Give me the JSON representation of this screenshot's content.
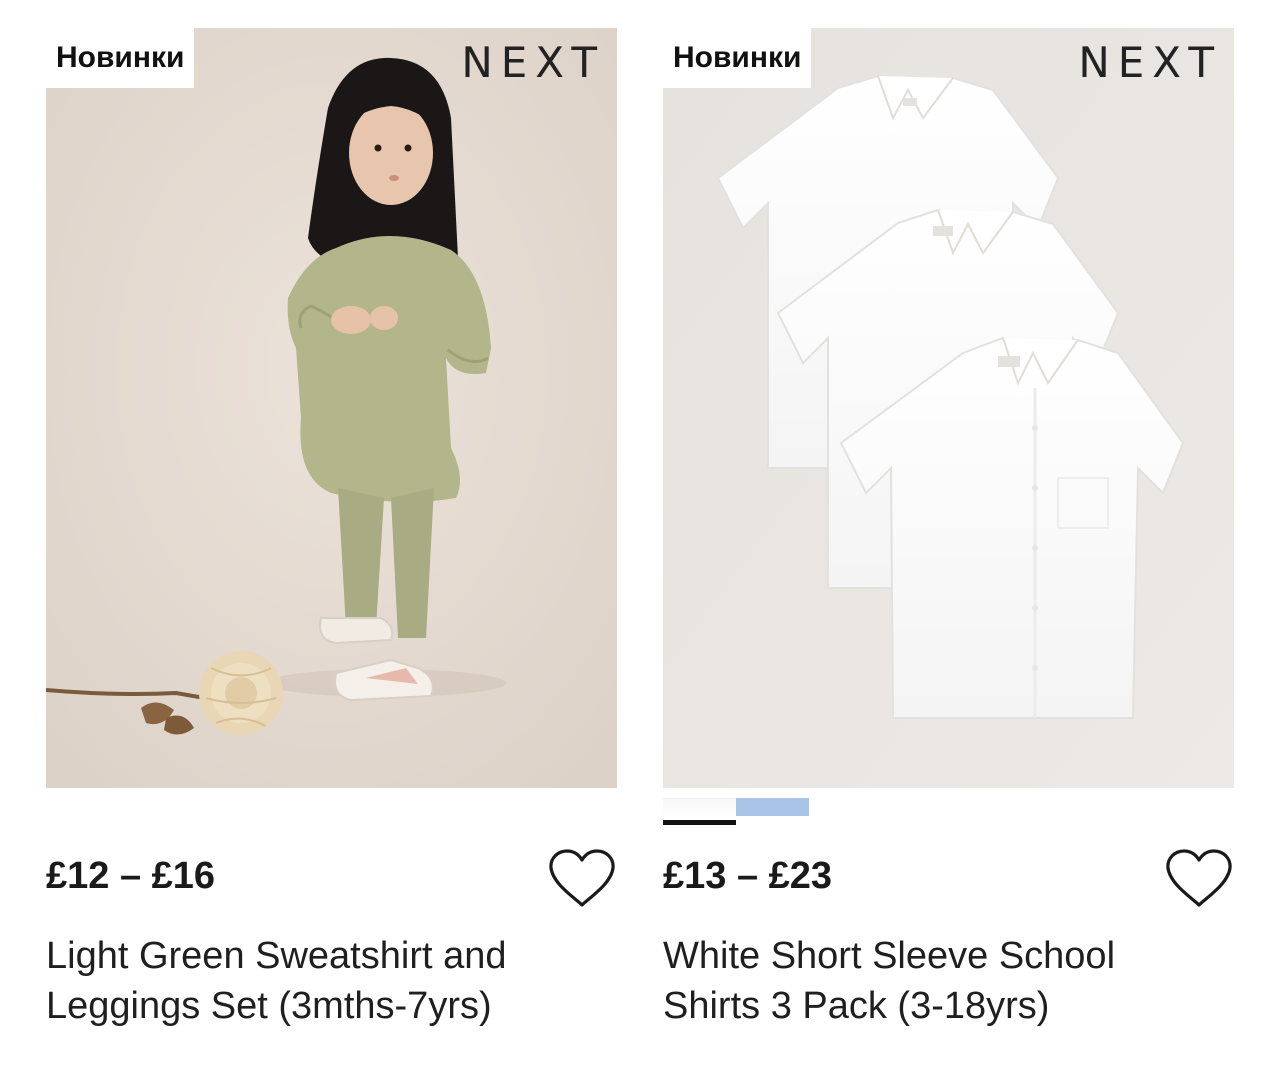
{
  "products": [
    {
      "badge": "Новинки",
      "brand": "NEXT",
      "price": "£12 – £16",
      "title_lines": [
        "Light Green Sweatshirt and",
        "Leggings Set (3mths-7yrs)"
      ],
      "image_icon": "child-in-green-outfit-photo",
      "colors": {
        "bg": "#e5dbd2",
        "garment": "#b2b48a"
      }
    },
    {
      "badge": "Новинки",
      "brand": "NEXT",
      "price": "£13 – £23",
      "title_lines": [
        "White Short Sleeve School",
        "Shirts 3 Pack (3-18yrs)"
      ],
      "image_icon": "white-shirts-photo",
      "colors": {
        "bg": "#e9e6e3",
        "garment": "#ffffff"
      },
      "swatches": [
        "#ffffff",
        "#a9c4e6"
      ],
      "selected_swatch": 0
    }
  ]
}
